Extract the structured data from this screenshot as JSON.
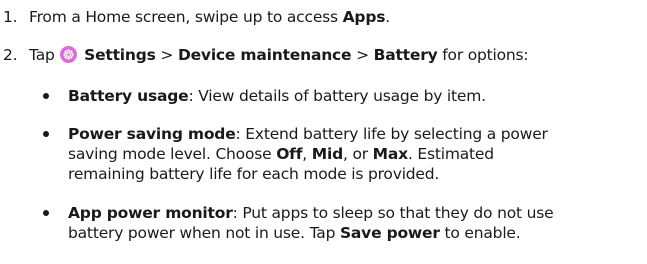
{
  "steps": [
    {
      "number": "1.",
      "text_a": "From a Home screen, swipe up to access ",
      "bold_a": "Apps",
      "text_b": "."
    },
    {
      "number": "2.",
      "text_a": "Tap ",
      "icon": "settings-gear-icon",
      "bold_a": "Settings",
      "sep1": " > ",
      "bold_b": "Device maintenance",
      "sep2": " > ",
      "bold_c": "Battery",
      "text_b": " for options:"
    }
  ],
  "bullets": [
    {
      "term": "Battery usage",
      "lines": [
        ": View details of battery usage by item."
      ]
    },
    {
      "term": "Power saving mode",
      "line1": ": Extend battery life by selecting a power",
      "line2_a": "saving mode level. Choose ",
      "off": "Off",
      "comma1": ", ",
      "mid": "Mid",
      "or": ", or ",
      "max": "Max",
      "line2_b": ". Estimated",
      "line3": "remaining battery life for each mode is provided."
    },
    {
      "term": "App power monitor",
      "line1": ": Put apps to sleep so that they do not use",
      "line2_a": "battery power when not in use. Tap ",
      "save": "Save power",
      "line2_b": " to enable."
    }
  ],
  "colors": {
    "text": "#1a1a1a",
    "settings_icon": "#d86ed6"
  }
}
